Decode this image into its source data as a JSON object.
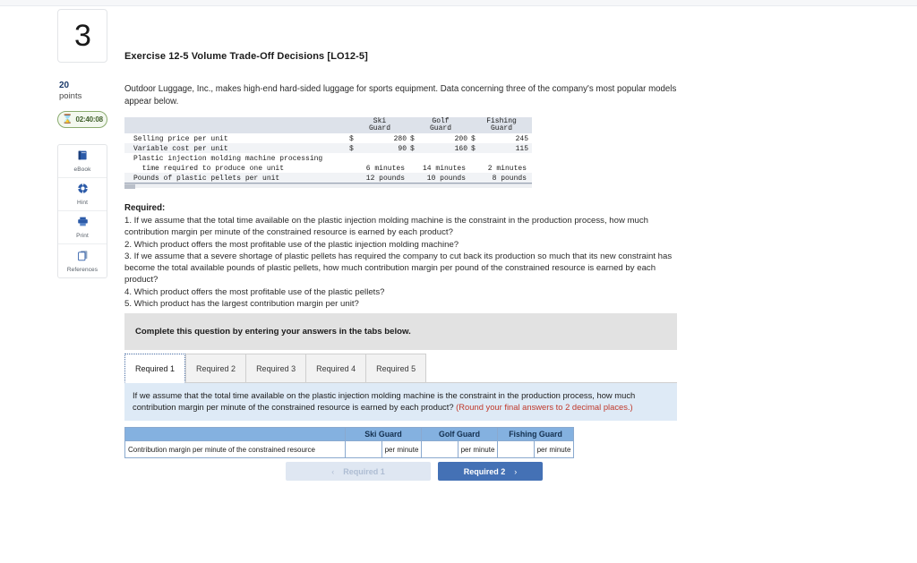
{
  "question": {
    "number": "3",
    "points_value": "20",
    "points_label": "points",
    "timer": "02:40:08",
    "timer_icon": "hourglass-icon"
  },
  "tools": [
    {
      "label": "eBook",
      "icon": "book-icon"
    },
    {
      "label": "Hint",
      "icon": "lifebuoy-icon"
    },
    {
      "label": "Print",
      "icon": "printer-icon"
    },
    {
      "label": "References",
      "icon": "copy-icon"
    }
  ],
  "exercise": {
    "title": "Exercise 12-5 Volume Trade-Off Decisions [LO12-5]",
    "intro": "Outdoor Luggage, Inc., makes high-end hard-sided luggage for sports equipment. Data concerning three of the company's most popular models appear below."
  },
  "data_table": {
    "columns": [
      "Ski Guard",
      "Golf Guard",
      "Fishing Guard"
    ],
    "column_lines": [
      [
        "Ski",
        "Guard"
      ],
      [
        "Golf",
        "Guard"
      ],
      [
        "Fishing",
        "Guard"
      ]
    ],
    "rows": [
      {
        "label": "Selling price per unit",
        "label2": "",
        "currency": "$",
        "values": [
          "280",
          "200",
          "245"
        ],
        "units": [
          "",
          "",
          ""
        ]
      },
      {
        "label": "Variable cost per unit",
        "label2": "",
        "currency": "$",
        "values": [
          "90",
          "160",
          "115"
        ],
        "units": [
          "",
          "",
          ""
        ]
      },
      {
        "label": "Plastic injection molding machine processing",
        "label2": "  time required to produce one unit",
        "currency": "",
        "values": [
          "6 minutes",
          "14 minutes",
          "2 minutes"
        ],
        "units": [
          "",
          "",
          ""
        ]
      },
      {
        "label": "Pounds of plastic pellets per unit",
        "label2": "",
        "currency": "",
        "values": [
          "12 pounds",
          "10 pounds",
          "8 pounds"
        ],
        "units": [
          "",
          "",
          ""
        ]
      }
    ]
  },
  "required": {
    "heading": "Required:",
    "items": [
      "1. If we assume that the total time available on the plastic injection molding machine is the constraint in the production process, how much contribution margin per minute of the constrained resource is earned by each product?",
      "2. Which product offers the most profitable use of the plastic injection molding machine?",
      "3. If we assume that a severe shortage of plastic pellets has required the company to cut back its production so much that its new constraint has become the total available pounds of plastic pellets, how much contribution margin per pound of the constrained resource is earned by each product?",
      "4. Which product offers the most profitable use of the plastic pellets?",
      "5. Which product has the largest contribution margin per unit?"
    ]
  },
  "answer_panel": {
    "banner": "Complete this question by entering your answers in the tabs below.",
    "tabs": [
      {
        "label": "Required 1",
        "active": true
      },
      {
        "label": "Required 2",
        "active": false
      },
      {
        "label": "Required 3",
        "active": false
      },
      {
        "label": "Required 4",
        "active": false
      },
      {
        "label": "Required 5",
        "active": false
      }
    ],
    "prompt": "If we assume that the total time available on the plastic injection molding machine is the constraint in the production process, how much contribution margin per minute of the constrained resource is earned by each product?",
    "round_note": "(Round your final answers to 2 decimal places.)",
    "grid": {
      "corner": "",
      "headers": [
        "Ski Guard",
        "Golf Guard",
        "Fishing Guard"
      ],
      "row_label": "Contribution margin per minute of the constrained resource",
      "inputs": [
        "",
        "",
        ""
      ],
      "unit_labels": [
        "per minute",
        "per minute",
        "per minute"
      ]
    },
    "nav": {
      "prev_label": "Required 1",
      "prev_chevron": "‹",
      "next_label": "Required 2",
      "next_chevron": "›"
    }
  },
  "colors": {
    "accent_blue": "#4471b5",
    "grid_header_blue": "#84b1e0",
    "info_blue": "#deeaf6",
    "banner_gray": "#e2e2e2",
    "note_red": "#c0392b",
    "timer_green": "#8aab6e"
  }
}
